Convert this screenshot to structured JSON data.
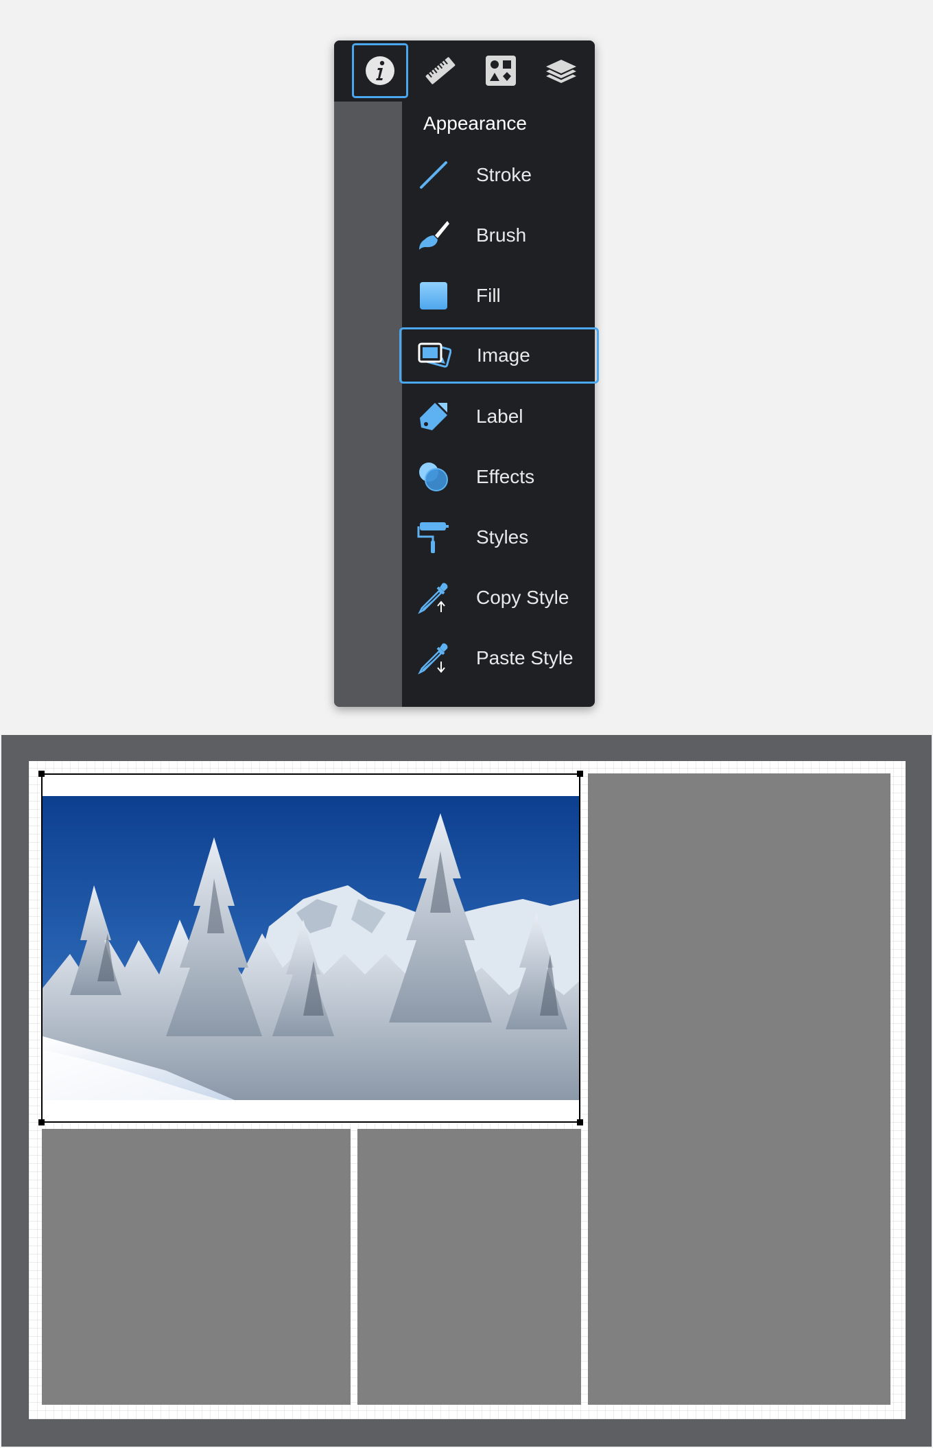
{
  "inspector": {
    "tabs": [
      {
        "icon": "info-icon",
        "active": true
      },
      {
        "icon": "ruler-icon",
        "active": false
      },
      {
        "icon": "shapes-icon",
        "active": false
      },
      {
        "icon": "layers-icon",
        "active": false
      }
    ],
    "section_title": "Appearance",
    "items": [
      {
        "label": "Stroke",
        "icon": "stroke-icon"
      },
      {
        "label": "Brush",
        "icon": "brush-icon"
      },
      {
        "label": "Fill",
        "icon": "fill-icon"
      },
      {
        "label": "Image",
        "icon": "image-icon",
        "selected": true
      },
      {
        "label": "Label",
        "icon": "label-tag-icon"
      },
      {
        "label": "Effects",
        "icon": "effects-icon"
      },
      {
        "label": "Styles",
        "icon": "paint-roller-icon"
      },
      {
        "label": "Copy Style",
        "icon": "copy-style-eyedropper-icon"
      },
      {
        "label": "Paste Style",
        "icon": "paste-style-eyedropper-icon"
      }
    ],
    "colors": {
      "panel_bg": "#1f2023",
      "rail_bg": "#55575b",
      "accent": "#4aa8f0",
      "icon_blue": "#5fb2f2"
    }
  },
  "canvas": {
    "colors": {
      "canvas_bg": "#5d5f63",
      "page_bg": "#ffffff",
      "empty_frame": "#808080"
    },
    "frames": [
      {
        "name": "image-frame",
        "content": "snowy-mountain-photo",
        "selected": true
      },
      {
        "name": "empty-frame-bottom-left",
        "content": "empty"
      },
      {
        "name": "empty-frame-bottom-middle",
        "content": "empty"
      },
      {
        "name": "empty-frame-right",
        "content": "empty"
      }
    ]
  }
}
